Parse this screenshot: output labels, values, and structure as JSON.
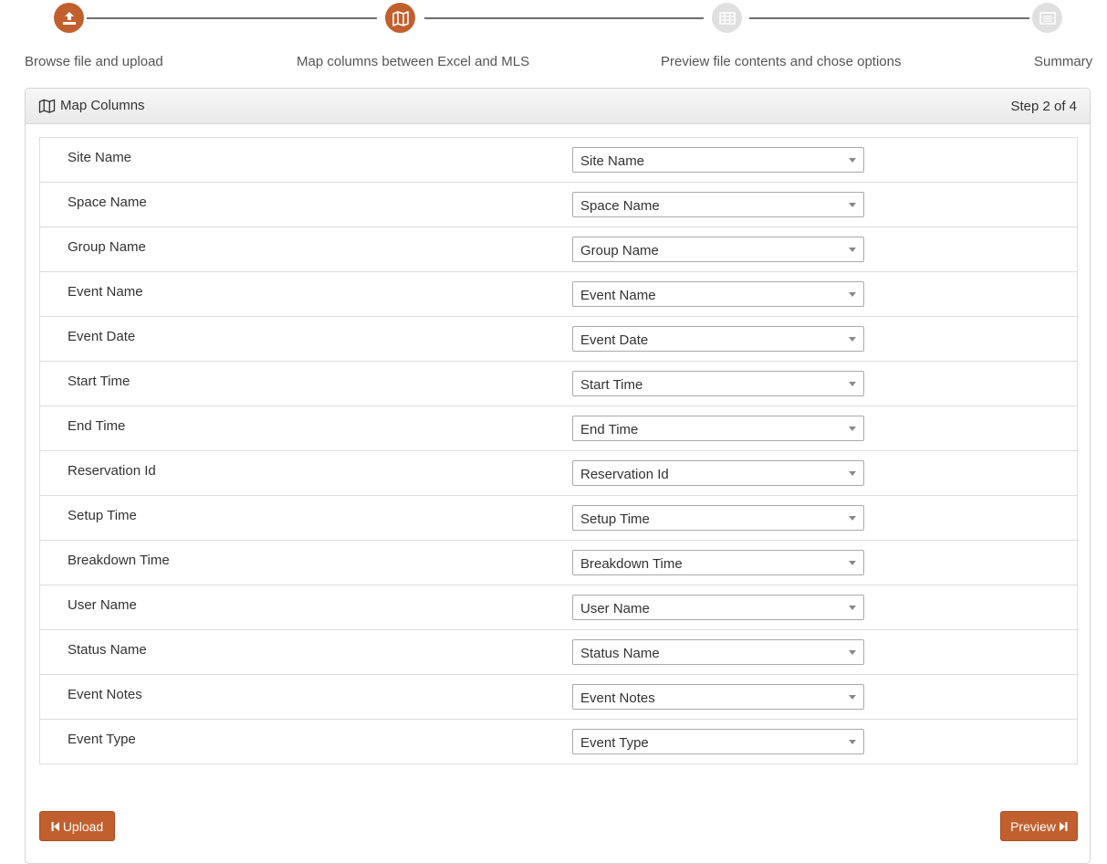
{
  "wizard": {
    "steps": [
      {
        "label": "Browse file and upload",
        "status": "complete",
        "icon": "upload-icon"
      },
      {
        "label": "Map columns between Excel and MLS",
        "status": "active",
        "icon": "map-icon"
      },
      {
        "label": "Preview file contents and chose options",
        "status": "inactive",
        "icon": "table-icon"
      },
      {
        "label": "Summary",
        "status": "inactive",
        "icon": "list-icon"
      }
    ]
  },
  "panel": {
    "title": "Map Columns",
    "title_icon": "map-icon",
    "step_text": "Step 2 of 4"
  },
  "mappings": [
    {
      "label": "Site Name",
      "selected": "Site Name"
    },
    {
      "label": "Space Name",
      "selected": "Space Name"
    },
    {
      "label": "Group Name",
      "selected": "Group Name"
    },
    {
      "label": "Event Name",
      "selected": "Event Name"
    },
    {
      "label": "Event Date",
      "selected": "Event Date"
    },
    {
      "label": "Start Time",
      "selected": "Start Time"
    },
    {
      "label": "End Time",
      "selected": "End Time"
    },
    {
      "label": "Reservation Id",
      "selected": "Reservation Id"
    },
    {
      "label": "Setup Time",
      "selected": "Setup Time"
    },
    {
      "label": "Breakdown Time",
      "selected": "Breakdown Time"
    },
    {
      "label": "User Name",
      "selected": "User Name"
    },
    {
      "label": "Status Name",
      "selected": "Status Name"
    },
    {
      "label": "Event Notes",
      "selected": "Event Notes"
    },
    {
      "label": "Event Type",
      "selected": "Event Type"
    }
  ],
  "buttons": {
    "upload_label": "Upload",
    "upload_icon": "step-backward-icon",
    "preview_label": "Preview",
    "preview_icon": "step-forward-icon"
  },
  "colors": {
    "accent": "#c1602e",
    "inactive_step": "#e0e0e0"
  }
}
